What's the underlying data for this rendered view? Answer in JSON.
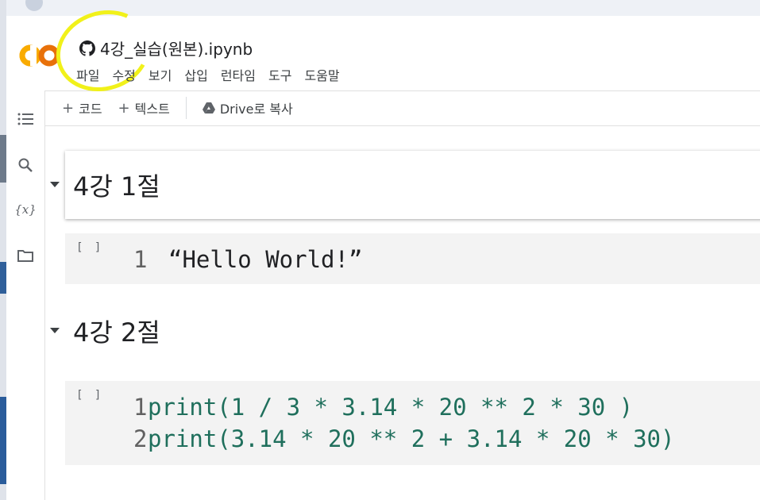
{
  "notebook": {
    "title": "4강_실습(원본).ipynb",
    "logo_text": "CO"
  },
  "menu": [
    "파일",
    "수정",
    "보기",
    "삽입",
    "런타임",
    "도구",
    "도움말"
  ],
  "toolbar": {
    "code_label": "코드",
    "text_label": "텍스트",
    "drive_label": "Drive로 복사"
  },
  "rail": {
    "icons": [
      "list-icon",
      "search-icon",
      "variables-icon",
      "folder-icon"
    ],
    "variables_glyph": "{x}"
  },
  "cells": {
    "section1_heading": "4강 1절",
    "cell1_run": "[ ]",
    "cell1_line1_no": "1",
    "cell1_line1_code": "“Hello World!”",
    "section2_heading": "4강 2절",
    "cell2_run": "[ ]",
    "cell2_line1_no": "1",
    "cell2_line1_code": "print(1 / 3 * 3.14 * 20 ** 2 * 30 )",
    "cell2_line2_no": "2",
    "cell2_line2_code": "print(3.14 * 20 ** 2 + 3.14 * 20 * 30)"
  },
  "colors": {
    "logo_orange": "#f9ab00",
    "logo_dark_orange": "#e8710a",
    "annotation_yellow": "#f1f11a",
    "number_green": "#11805e"
  }
}
